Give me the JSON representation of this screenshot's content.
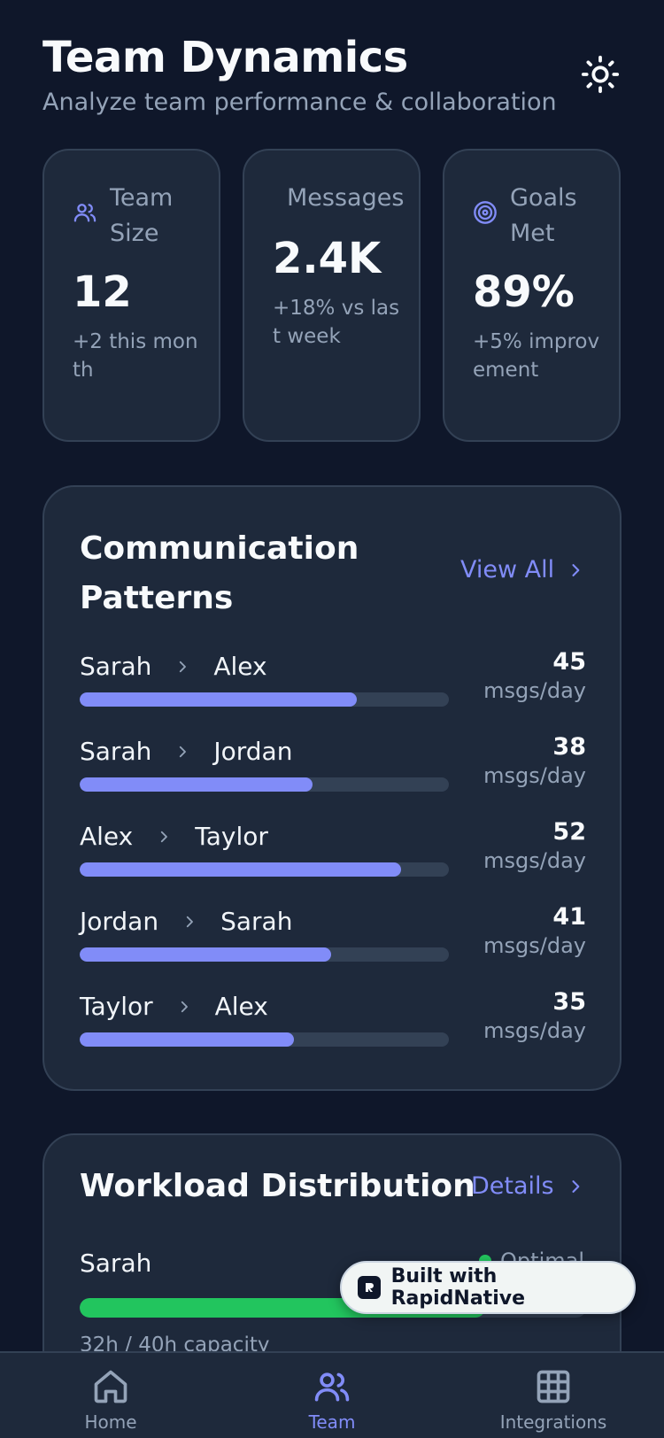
{
  "header": {
    "title": "Team Dynamics",
    "subtitle": "Analyze team performance & collaboration",
    "theme_icon": "sun-icon"
  },
  "stats": [
    {
      "label": "Team Size",
      "value": "12",
      "delta": "+2 this month",
      "icon": "users-icon"
    },
    {
      "label": "Messages",
      "value": "2.4K",
      "delta": "+18% vs last week",
      "icon": ""
    },
    {
      "label": "Goals Met",
      "value": "89%",
      "delta": "+5% improvement",
      "icon": "target-icon"
    }
  ],
  "communication": {
    "title": "Communication Patterns",
    "link": "View All",
    "rows": [
      {
        "from": "Sarah",
        "to": "Alex",
        "count": "45",
        "unit": "msgs/day",
        "level": 0.75
      },
      {
        "from": "Sarah",
        "to": "Jordan",
        "count": "38",
        "unit": "msgs/day",
        "level": 0.63
      },
      {
        "from": "Alex",
        "to": "Taylor",
        "count": "52",
        "unit": "msgs/day",
        "level": 0.87
      },
      {
        "from": "Jordan",
        "to": "Sarah",
        "count": "41",
        "unit": "msgs/day",
        "level": 0.68
      },
      {
        "from": "Taylor",
        "to": "Alex",
        "count": "35",
        "unit": "msgs/day",
        "level": 0.58
      }
    ]
  },
  "workload": {
    "title": "Workload Distribution",
    "link": "Details",
    "member": {
      "name": "Sarah",
      "status": "Optimal",
      "capacity": "32h / 40h capacity",
      "level": 0.8
    }
  },
  "badge": {
    "text": "Built with RapidNative"
  },
  "tabs": [
    {
      "label": "Home",
      "icon": "home-icon",
      "active": false
    },
    {
      "label": "Team",
      "icon": "team-icon",
      "active": true
    },
    {
      "label": "Integrations",
      "icon": "grid-icon",
      "active": false
    }
  ],
  "colors": {
    "background": "#0f172a",
    "card": "#1e293b",
    "accent": "#818cf8",
    "success": "#22c55e",
    "muted": "#94a3b8"
  }
}
